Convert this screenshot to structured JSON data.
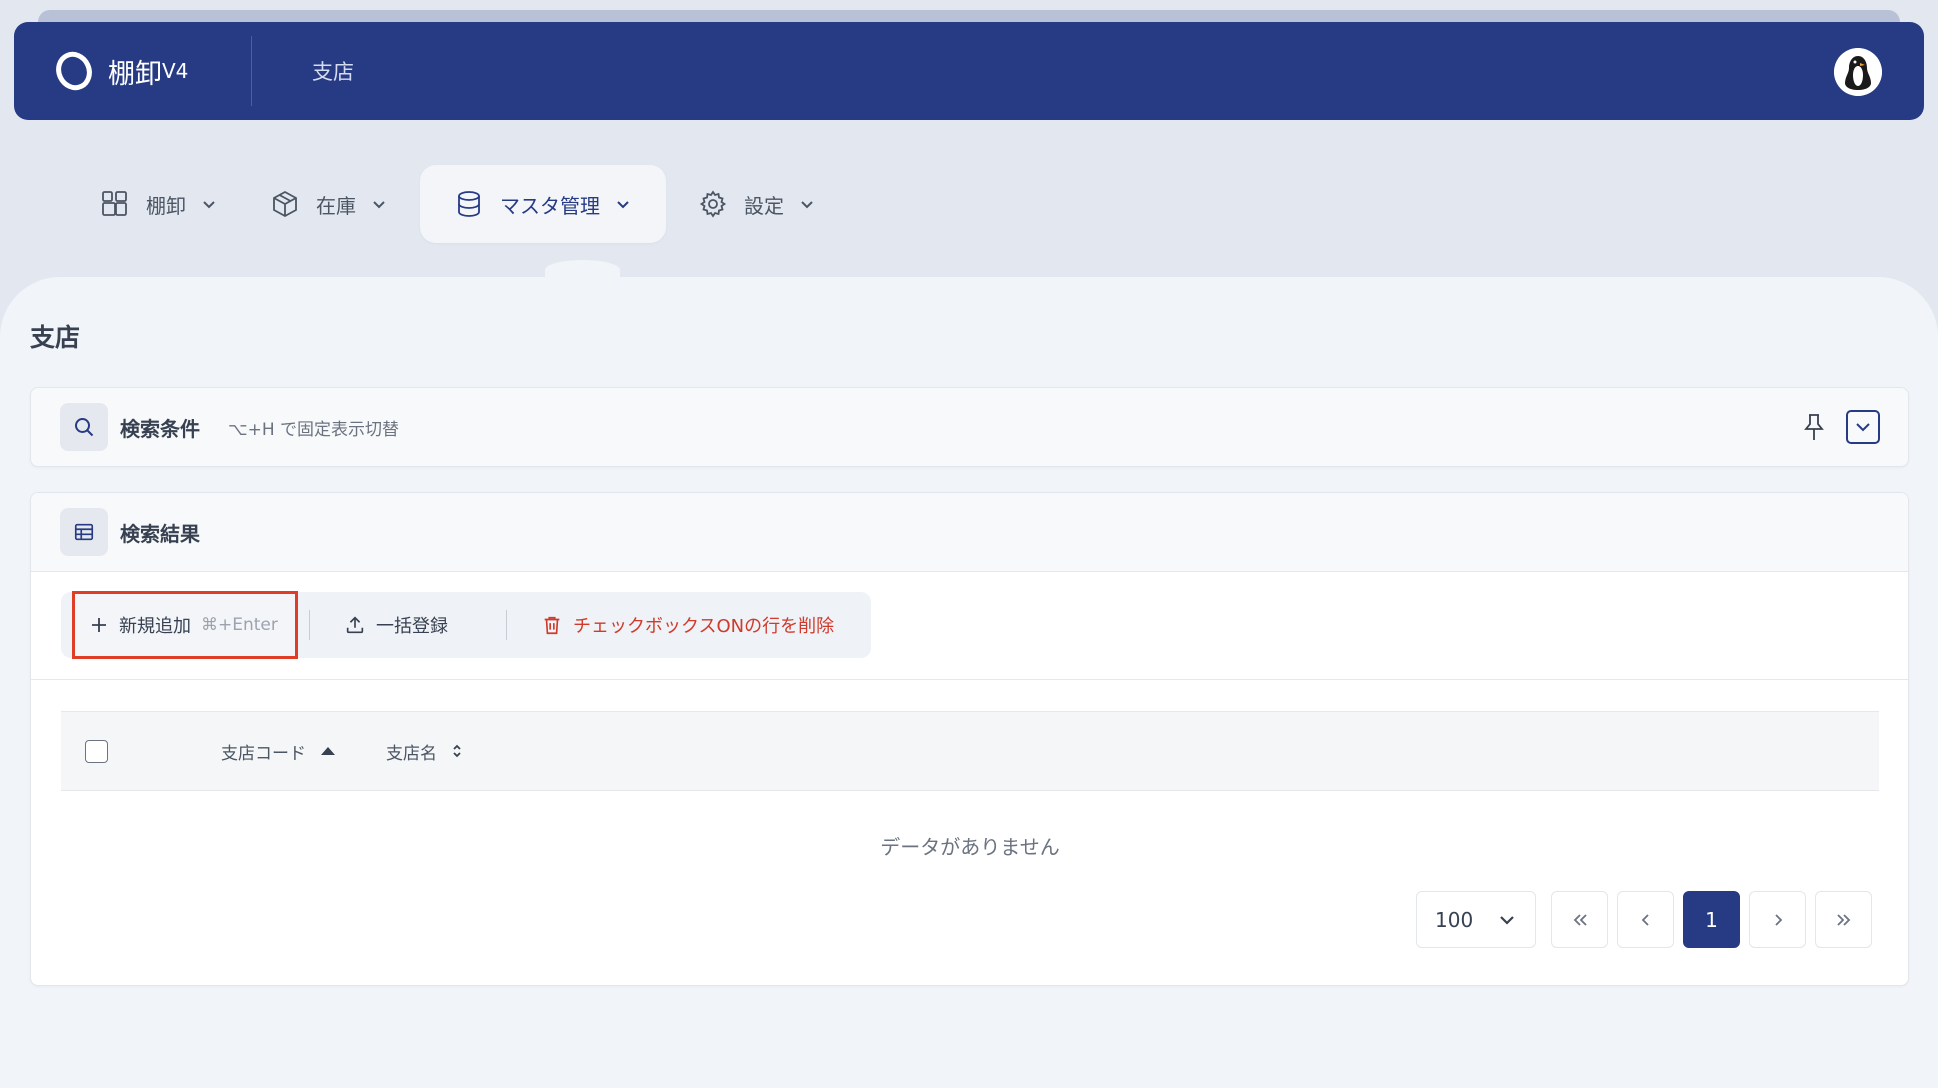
{
  "header": {
    "app_name": "棚卸",
    "app_version": "V4",
    "page_name": "支店"
  },
  "nav": {
    "items": [
      {
        "label": "棚卸",
        "icon": "grid-plus-icon"
      },
      {
        "label": "在庫",
        "icon": "box-icon"
      },
      {
        "label": "マスタ管理",
        "icon": "database-icon",
        "active": true
      },
      {
        "label": "設定",
        "icon": "gear-icon"
      }
    ]
  },
  "page": {
    "title": "支店"
  },
  "search": {
    "title": "検索条件",
    "hint": "⌥+H で固定表示切替"
  },
  "results": {
    "title": "検索結果",
    "toolbar": {
      "add_label": "新規追加",
      "add_shortcut": "⌘+Enter",
      "bulk_label": "一括登録",
      "delete_label": "チェックボックスONの行を削除"
    },
    "columns": [
      "支店コード",
      "支店名"
    ],
    "empty_text": "データがありません",
    "pagination": {
      "page_size": "100",
      "current_page": "1"
    }
  },
  "colors": {
    "primary": "#273b85",
    "danger": "#d03a2b",
    "highlight_border": "#e03d26"
  }
}
